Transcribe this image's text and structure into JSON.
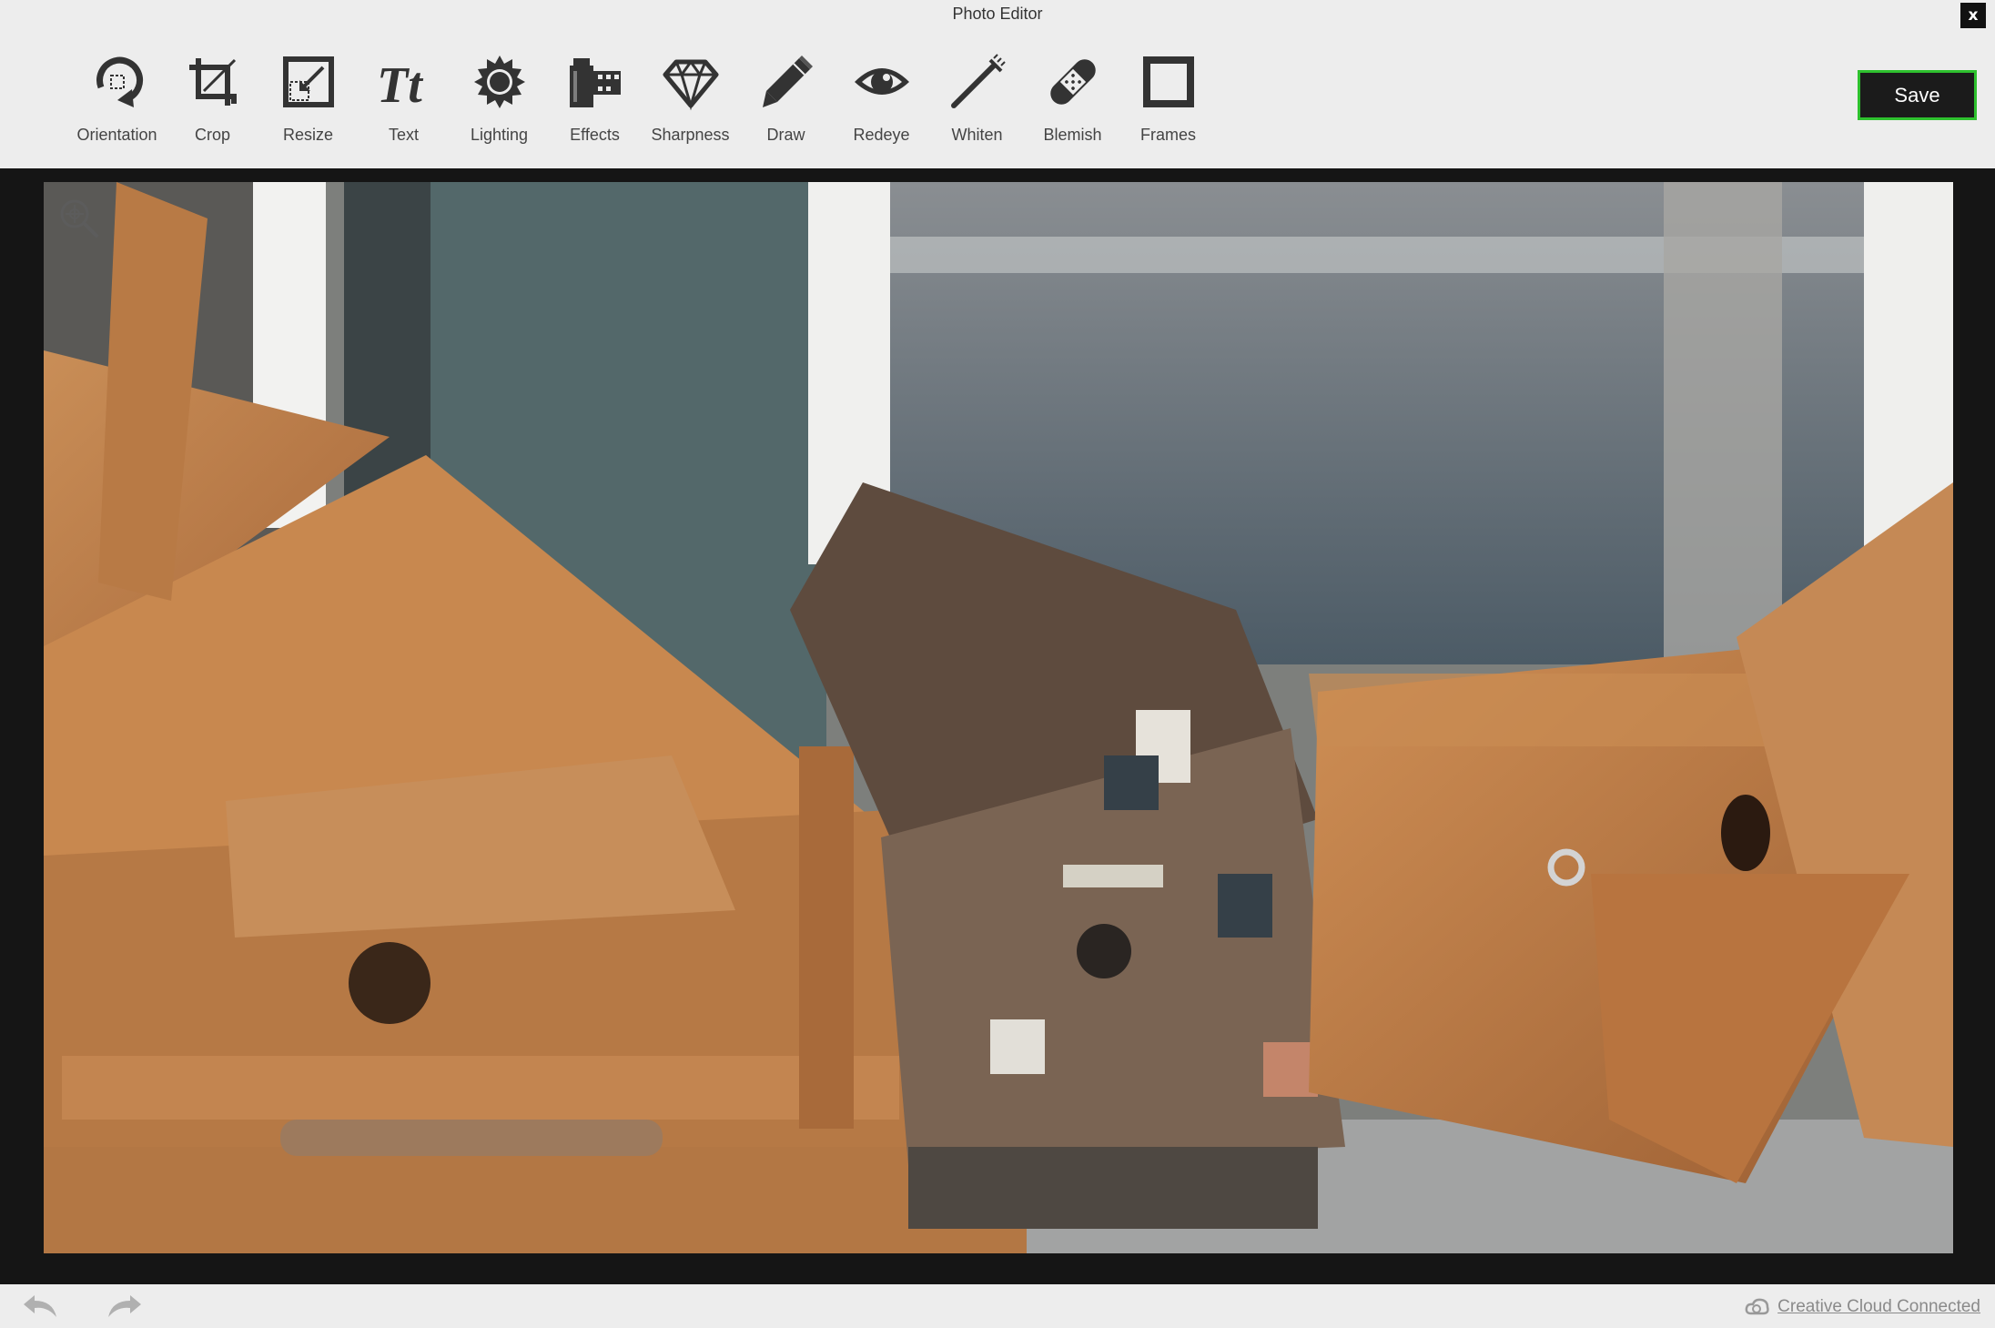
{
  "window": {
    "title": "Photo Editor",
    "close_label": "x"
  },
  "toolbar": {
    "tools": [
      {
        "label": "Orientation",
        "icon": "orientation-icon"
      },
      {
        "label": "Crop",
        "icon": "crop-icon"
      },
      {
        "label": "Resize",
        "icon": "resize-icon"
      },
      {
        "label": "Text",
        "icon": "text-icon"
      },
      {
        "label": "Lighting",
        "icon": "lighting-icon"
      },
      {
        "label": "Effects",
        "icon": "effects-icon"
      },
      {
        "label": "Sharpness",
        "icon": "sharpness-icon"
      },
      {
        "label": "Draw",
        "icon": "draw-icon"
      },
      {
        "label": "Redeye",
        "icon": "redeye-icon"
      },
      {
        "label": "Whiten",
        "icon": "whiten-icon"
      },
      {
        "label": "Blemish",
        "icon": "blemish-icon"
      },
      {
        "label": "Frames",
        "icon": "frames-icon"
      }
    ],
    "save_label": "Save",
    "text_icon_glyph": "Tt"
  },
  "canvas": {
    "zoom_icon": "zoom-icon",
    "photo_subject": "wooden-birdhouses-photo"
  },
  "footer": {
    "undo_icon": "undo-icon",
    "redo_icon": "redo-icon",
    "status_label": "Creative Cloud Connected",
    "status_icon": "creative-cloud-icon"
  },
  "colors": {
    "background": "#ededed",
    "canvas": "#151515",
    "icon": "#333333",
    "save_bg": "#1b1b1b",
    "save_border": "#2ec12e"
  }
}
